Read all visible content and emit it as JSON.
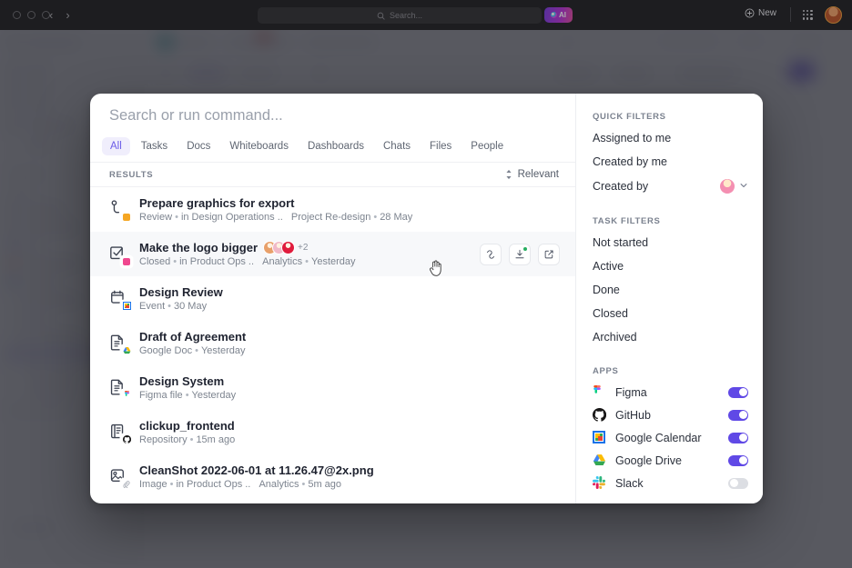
{
  "titlebar": {
    "nav_back": "‹",
    "nav_forward": "›",
    "search_placeholder": "Search...",
    "search_icon": "search-icon",
    "ai_label": "AI",
    "new_label": "New",
    "apps_grid_icon": "grid-apps-icon",
    "avatar_icon": "user-avatar"
  },
  "palette": {
    "search": {
      "value": "",
      "placeholder": "Search or run command..."
    },
    "tabs": [
      {
        "label": "All",
        "active": true
      },
      {
        "label": "Tasks",
        "active": false
      },
      {
        "label": "Docs",
        "active": false
      },
      {
        "label": "Whiteboards",
        "active": false
      },
      {
        "label": "Dashboards",
        "active": false
      },
      {
        "label": "Chats",
        "active": false
      },
      {
        "label": "Files",
        "active": false
      },
      {
        "label": "People",
        "active": false
      }
    ],
    "results_header": {
      "label": "RESULTS",
      "sort_label": "Relevant",
      "sort_icon": "sort-updown-icon"
    },
    "results": [
      {
        "title": "Prepare graphics for export",
        "type": "Review",
        "location": "in Design Operations ..",
        "list": "Project Re-design",
        "date": "28 May",
        "icon": "task-phone-icon",
        "badge_color": "#f5a623",
        "hovered": false,
        "avatars": [],
        "avatar_overflow": ""
      },
      {
        "title": "Make the logo bigger",
        "type": "Closed",
        "location": "in Product Ops ..",
        "list": "Analytics",
        "date": "Yesterday",
        "icon": "task-checked-icon",
        "badge_color": "#f0488f",
        "hovered": true,
        "avatars": [
          "#e8a06a",
          "#f0b9c8",
          "#e01b3c"
        ],
        "avatar_overflow": "+2",
        "actions": [
          {
            "name": "copy-link-button",
            "icon": "link-icon"
          },
          {
            "name": "share-button",
            "icon": "share-badge-icon",
            "badge": true
          },
          {
            "name": "open-external-button",
            "icon": "external-link-icon"
          }
        ]
      },
      {
        "title": "Design Review",
        "type": "Event",
        "location": "",
        "list": "",
        "date": "30 May",
        "icon": "calendar-icon",
        "badge_color": "#4285f4",
        "app_badge": "google-calendar",
        "hovered": false,
        "avatars": [],
        "avatar_overflow": ""
      },
      {
        "title": "Draft of Agreement",
        "type": "Google Doc",
        "location": "",
        "list": "",
        "date": "Yesterday",
        "icon": "document-icon",
        "badge_color": "#34a853",
        "app_badge": "google-drive",
        "hovered": false,
        "avatars": [],
        "avatar_overflow": ""
      },
      {
        "title": "Design System",
        "type": "Figma file",
        "location": "",
        "list": "",
        "date": "Yesterday",
        "icon": "document-icon",
        "badge_color": "#f24e1e",
        "app_badge": "figma",
        "hovered": false,
        "avatars": [],
        "avatar_overflow": ""
      },
      {
        "title": "clickup_frontend",
        "type": "Repository",
        "location": "",
        "list": "",
        "date": "15m ago",
        "icon": "repository-icon",
        "badge_color": "#181717",
        "app_badge": "github",
        "hovered": false,
        "avatars": [],
        "avatar_overflow": ""
      },
      {
        "title": "CleanShot 2022-06-01 at 11.26.47@2x.png",
        "type": "Image",
        "location": "in Product Ops ..",
        "list": "Analytics",
        "date": "5m ago",
        "icon": "image-icon",
        "badge_color": "#9aa0ab",
        "app_badge": "attachment",
        "hovered": false,
        "avatars": [],
        "avatar_overflow": ""
      }
    ],
    "sidebar": {
      "quick_filters_title": "QUICK FILTERS",
      "quick_filters": [
        {
          "label": "Assigned to me",
          "has_avatar": false,
          "has_chevron": false
        },
        {
          "label": "Created by me",
          "has_avatar": false,
          "has_chevron": false
        },
        {
          "label": "Created by",
          "has_avatar": true,
          "has_chevron": true,
          "avatar_color": "#f48fb1"
        }
      ],
      "task_filters_title": "TASK FILTERS",
      "task_filters": [
        {
          "label": "Not started"
        },
        {
          "label": "Active"
        },
        {
          "label": "Done"
        },
        {
          "label": "Closed"
        },
        {
          "label": "Archived"
        }
      ],
      "apps_title": "APPS",
      "apps": [
        {
          "label": "Figma",
          "icon": "figma-icon",
          "enabled": true
        },
        {
          "label": "GitHub",
          "icon": "github-icon",
          "enabled": true
        },
        {
          "label": "Google Calendar",
          "icon": "google-calendar-icon",
          "enabled": true
        },
        {
          "label": "Google Drive",
          "icon": "google-drive-icon",
          "enabled": true
        },
        {
          "label": "Slack",
          "icon": "slack-icon",
          "enabled": false
        }
      ]
    }
  },
  "colors": {
    "accent": "#6c5ce7",
    "toggle_on": "#6049e6",
    "toggle_off": "#dcdee3",
    "text_primary": "#1f2330",
    "text_secondary": "#7d848f"
  }
}
